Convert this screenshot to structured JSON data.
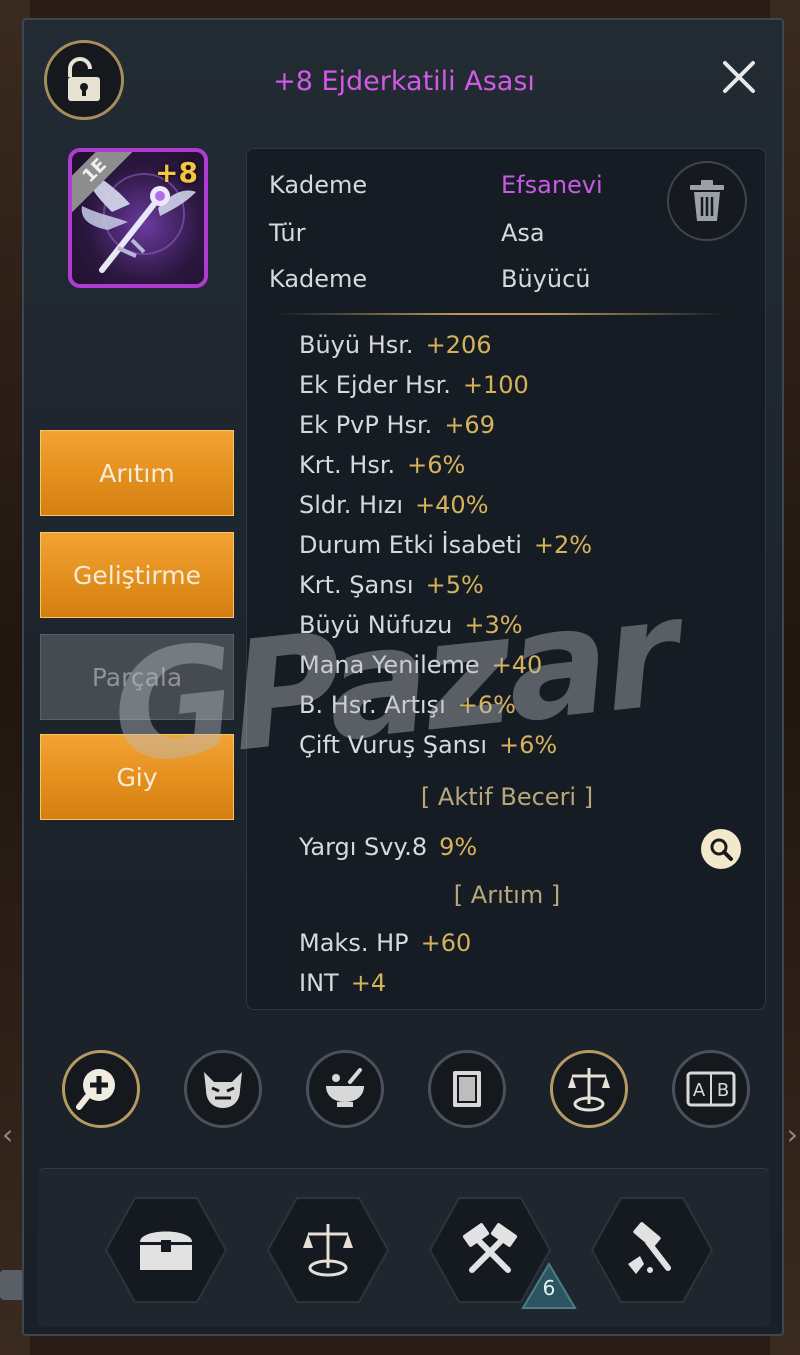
{
  "title": "+8 Ejderkatili Asası",
  "item": {
    "tier": "1E",
    "enhance": "+8"
  },
  "info": [
    {
      "label": "Kademe",
      "value": "Efsanevi",
      "color": "#c85ae6"
    },
    {
      "label": "Tür",
      "value": "Asa",
      "color": "#d6d9dd"
    },
    {
      "label": "Kademe",
      "value": "Büyücü",
      "color": "#d6d9dd"
    }
  ],
  "stats": [
    {
      "name": "Büyü Hsr.",
      "value": "+206"
    },
    {
      "name": "Ek Ejder Hsr.",
      "value": "+100"
    },
    {
      "name": "Ek PvP Hsr.",
      "value": "+69"
    },
    {
      "name": "Krt. Hsr.",
      "value": "+6%"
    },
    {
      "name": "Sldr. Hızı",
      "value": "+40%"
    },
    {
      "name": "Durum Etki İsabeti",
      "value": "+2%"
    },
    {
      "name": "Krt. Şansı",
      "value": "+5%"
    },
    {
      "name": "Büyü Nüfuzu",
      "value": "+3%"
    },
    {
      "name": "Mana Yenileme",
      "value": "+40"
    },
    {
      "name": "B. Hsr. Artışı",
      "value": "+6%"
    },
    {
      "name": "Çift Vuruş Şansı",
      "value": "+6%"
    }
  ],
  "active_skill_header": "[ Aktif Beceri ]",
  "active_skill": {
    "name": "Yargı Svy.8",
    "value": "9%"
  },
  "refine_header": "[ Arıtım ]",
  "refine_stats": [
    {
      "name": "Maks. HP",
      "value": "+60"
    },
    {
      "name": "INT",
      "value": "+4"
    }
  ],
  "side_buttons": {
    "refine": "Arıtım",
    "enhance": "Geliştirme",
    "dismantle": "Parçala",
    "equip": "Giy"
  },
  "circle_buttons": [
    "zoom-in-icon",
    "demon-mask-icon",
    "alchemy-bowl-icon",
    "book-icon",
    "scales-icon",
    "compare-ab-icon"
  ],
  "compare_label": "A B",
  "bottom_buttons": [
    "chest-icon",
    "scales-icon",
    "hammers-icon",
    "anvil-hammer-icon"
  ],
  "hammer_badge": "6",
  "watermark": "GPazar",
  "colors": {
    "accent_orange": "#e8941f",
    "title_purple": "#d25ae6",
    "stat_gold": "#d6b25b"
  }
}
